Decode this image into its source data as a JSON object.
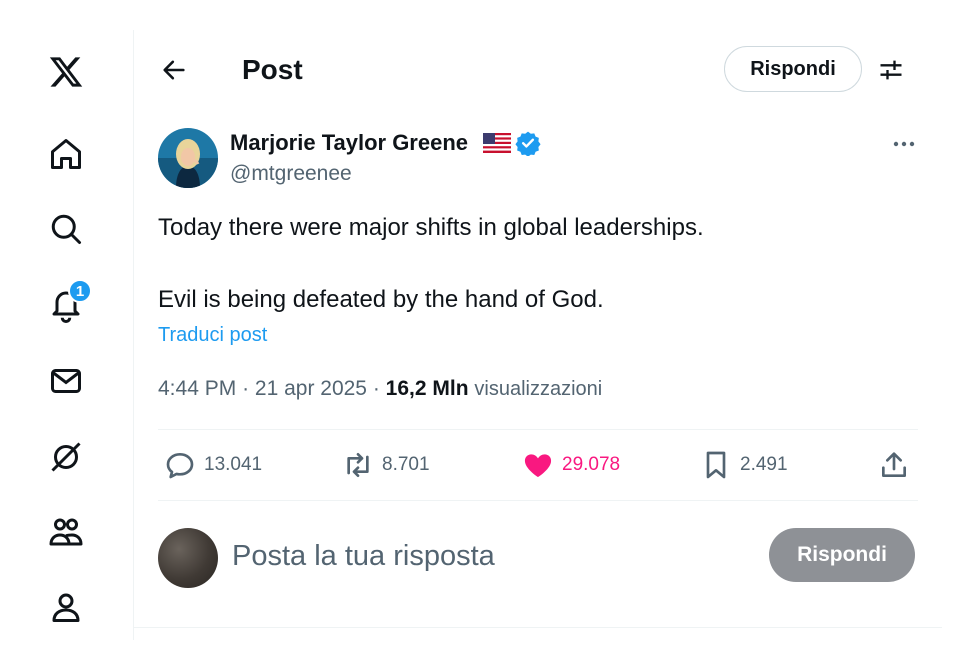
{
  "colors": {
    "accent": "#1d9bf0",
    "like": "#f91880",
    "text": "#0f1419",
    "secondary": "#536471",
    "border": "#cfd9de"
  },
  "sidebar": {
    "items": [
      {
        "name": "x-logo",
        "icon": "x-logo-icon"
      },
      {
        "name": "home",
        "icon": "home-icon"
      },
      {
        "name": "explore",
        "icon": "search-icon"
      },
      {
        "name": "notifications",
        "icon": "bell-icon",
        "badge": "1"
      },
      {
        "name": "messages",
        "icon": "mail-icon"
      },
      {
        "name": "grok",
        "icon": "grok-icon"
      },
      {
        "name": "communities",
        "icon": "people-icon"
      },
      {
        "name": "profile",
        "icon": "person-icon"
      }
    ]
  },
  "header": {
    "title": "Post",
    "reply_label": "Rispondi"
  },
  "post": {
    "author_name": "Marjorie Taylor Greene",
    "author_handle": "@mtgreenee",
    "text_line1": "Today there were major shifts in global leaderships.",
    "text_line2": "Evil is being defeated by the hand of God.",
    "translate": "Traduci post",
    "time": "4:44 PM",
    "date": "21 apr 2025",
    "views_count": "16,2 Mln",
    "views_label": "visualizzazioni"
  },
  "actions": {
    "replies": "13.041",
    "reposts": "8.701",
    "likes": "29.078",
    "bookmarks": "2.491"
  },
  "composer": {
    "placeholder": "Posta la tua risposta",
    "button": "Rispondi"
  }
}
